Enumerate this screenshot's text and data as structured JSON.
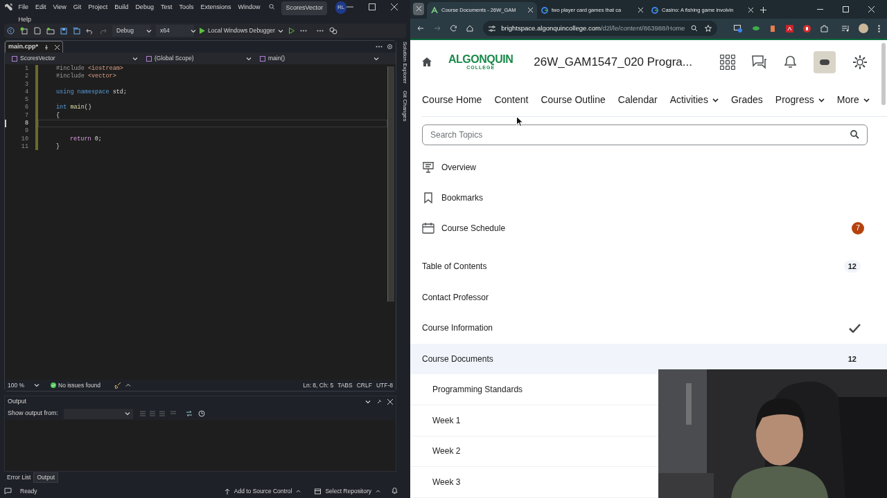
{
  "ide": {
    "menu": [
      "File",
      "Edit",
      "View",
      "Git",
      "Project",
      "Build",
      "Debug",
      "Test",
      "Tools",
      "Extensions",
      "Window",
      "Help"
    ],
    "solution": "ScoresVector",
    "account": "RL",
    "toolbar": {
      "configuration": "Debug",
      "platform": "x64",
      "debugger": "Local Windows Debugger"
    },
    "editor_tab": {
      "label": "main.cpp*"
    },
    "nav_bar": [
      "ScoresVector",
      "(Global Scope)",
      "main()"
    ],
    "code": [
      {
        "n": "1",
        "current": false,
        "tokens": [
          {
            "kind": "pp",
            "t": "#include "
          },
          {
            "kind": "str",
            "t": "<iostream>"
          }
        ]
      },
      {
        "n": "2",
        "current": false,
        "tokens": [
          {
            "kind": "pp",
            "t": "#include "
          },
          {
            "kind": "str",
            "t": "<vector>"
          }
        ]
      },
      {
        "n": "3",
        "current": false
      },
      {
        "n": "4",
        "current": false,
        "tokens": [
          {
            "kind": "kw",
            "t": "using namespace "
          },
          {
            "kind": "txt",
            "t": "std;"
          }
        ]
      },
      {
        "n": "5",
        "current": false
      },
      {
        "n": "6",
        "current": false,
        "tokens": [
          {
            "kind": "kw",
            "t": "int "
          },
          {
            "kind": "fn",
            "t": "main"
          },
          {
            "kind": "txt",
            "t": "()"
          }
        ]
      },
      {
        "n": "7",
        "current": false,
        "tokens": [
          {
            "kind": "txt",
            "t": "{"
          }
        ]
      },
      {
        "n": "8",
        "current": true
      },
      {
        "n": "9",
        "current": false
      },
      {
        "n": "10",
        "current": false,
        "indented": true,
        "tokens": [
          {
            "kind": "ctl",
            "t": "return "
          },
          {
            "kind": "txt",
            "t": "0;"
          }
        ]
      },
      {
        "n": "11",
        "current": false,
        "tokens": [
          {
            "kind": "txt",
            "t": "}"
          }
        ]
      }
    ],
    "status": {
      "zoom": "100 %",
      "issues": "No issues found",
      "position": "Ln: 8, Ch: 5",
      "indent": "TABS",
      "line_endings": "CRLF",
      "encoding": "UTF-8"
    },
    "output": {
      "title": "Output",
      "show_from": "Show output from:"
    },
    "bottom_tabs": [
      {
        "label": "Error List",
        "selected": false
      },
      {
        "label": "Output",
        "selected": true
      }
    ],
    "side_tabs": [
      "Solution Explorer",
      "Git Changes"
    ],
    "status_bar": {
      "state": "Ready",
      "source_control": "Add to Source Control",
      "repository": "Select Repository"
    }
  },
  "browser": {
    "tabs": [
      {
        "title": "Course Documents - 26W_GAM",
        "selected": true,
        "kind": "brightspace"
      },
      {
        "title": "two player card games that ca",
        "selected": false,
        "kind": "google"
      },
      {
        "title": "Casino: A fishing game involvin",
        "selected": false,
        "kind": "google"
      }
    ],
    "address": {
      "host": "brightspace.algonquincollege.com",
      "path": "/d2l/le/content/863988/Home"
    },
    "page": {
      "logo": [
        "ALGONQUIN",
        "COLLEGE"
      ],
      "course_title": "26W_GAM1547_020 Progra...",
      "nav": [
        {
          "label": "Course Home",
          "dropdown": false
        },
        {
          "label": "Content",
          "dropdown": false
        },
        {
          "label": "Course Outline",
          "dropdown": false
        },
        {
          "label": "Calendar",
          "dropdown": false
        },
        {
          "label": "Activities",
          "dropdown": true
        },
        {
          "label": "Grades",
          "dropdown": false
        },
        {
          "label": "Progress",
          "dropdown": true
        },
        {
          "label": "More",
          "dropdown": true
        }
      ],
      "search": {
        "placeholder": "Search Topics"
      },
      "tools": [
        {
          "kind": "overview",
          "label": "Overview"
        },
        {
          "kind": "bookmarks",
          "label": "Bookmarks"
        },
        {
          "kind": "schedule",
          "label": "Course Schedule",
          "badge": "7"
        }
      ],
      "modules": [
        {
          "label": "Table of Contents",
          "count": "12",
          "completed": false,
          "selected": false
        },
        {
          "label": "Contact Professor",
          "completed": false,
          "selected": false
        },
        {
          "label": "Course Information",
          "completed": true,
          "selected": false
        },
        {
          "label": "Course Documents",
          "count": "12",
          "completed": false,
          "selected": true,
          "children": [
            {
              "label": "Programming Standards"
            },
            {
              "label": "Week 1"
            },
            {
              "label": "Week 2"
            },
            {
              "label": "Week 3"
            }
          ]
        }
      ]
    }
  }
}
